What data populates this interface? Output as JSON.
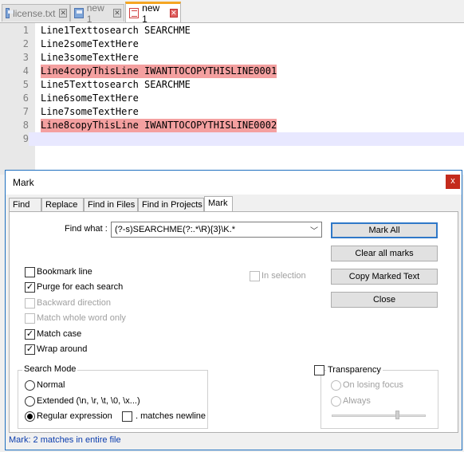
{
  "tabs": [
    {
      "label": "license.txt",
      "icon": "file-icon",
      "active": false
    },
    {
      "label": "new 1",
      "icon": "file-icon",
      "active": false
    },
    {
      "label": "new 1",
      "icon": "file-icon",
      "active": true
    }
  ],
  "editor": {
    "lines": [
      {
        "num": "1",
        "text": "Line1Texttosearch SEARCHME",
        "marked": false
      },
      {
        "num": "2",
        "text": "Line2someTextHere",
        "marked": false
      },
      {
        "num": "3",
        "text": "Line3someTextHere",
        "marked": false
      },
      {
        "num": "4",
        "text": "Line4copyThisLine IWANTTOCOPYTHISLINE0001",
        "marked": true
      },
      {
        "num": "5",
        "text": "Line5Texttosearch SEARCHME",
        "marked": false
      },
      {
        "num": "6",
        "text": "Line6someTextHere",
        "marked": false
      },
      {
        "num": "7",
        "text": "Line7someTextHere",
        "marked": false
      },
      {
        "num": "8",
        "text": "Line8copyThisLine IWANTTOCOPYTHISLINE0002",
        "marked": true
      },
      {
        "num": "9",
        "text": "",
        "marked": false
      }
    ],
    "mark_color": "#f4a0a0"
  },
  "dialog": {
    "title": "Mark",
    "close_symbol": "x",
    "tabs": [
      "Find",
      "Replace",
      "Find in Files",
      "Find in Projects",
      "Mark"
    ],
    "active_tab": "Mark",
    "find_what_label": "Find what :",
    "find_what_value": "(?-s)SEARCHME(?:.*\\R){3}\\K.*",
    "buttons": {
      "mark_all": "Mark All",
      "clear_all_marks": "Clear all marks",
      "copy_marked_text": "Copy Marked Text",
      "close": "Close"
    },
    "options": {
      "bookmark_line": {
        "label": "Bookmark line",
        "checked": false,
        "enabled": true
      },
      "purge": {
        "label": "Purge for each search",
        "checked": true,
        "enabled": true
      },
      "backward": {
        "label": "Backward direction",
        "checked": false,
        "enabled": false
      },
      "whole_word": {
        "label": "Match whole word only",
        "checked": false,
        "enabled": false
      },
      "match_case": {
        "label": "Match case",
        "checked": true,
        "enabled": true
      },
      "wrap_around": {
        "label": "Wrap around",
        "checked": true,
        "enabled": true
      },
      "in_selection": {
        "label": "In selection",
        "checked": false,
        "enabled": false
      }
    },
    "search_mode": {
      "title": "Search Mode",
      "normal": "Normal",
      "extended": "Extended (\\n, \\r, \\t, \\0, \\x...)",
      "regex": "Regular expression",
      "selected": "regex",
      "matches_newline": ". matches newline",
      "matches_newline_checked": false
    },
    "transparency": {
      "label": "Transparency",
      "checked": false,
      "on_losing_focus": "On losing focus",
      "always": "Always",
      "level": 0.75
    },
    "status": "Mark: 2 matches in entire file"
  },
  "colors": {
    "accent": "#1e6fbf",
    "status_text": "#0a3cad",
    "active_tab_top": "#f5a623"
  }
}
